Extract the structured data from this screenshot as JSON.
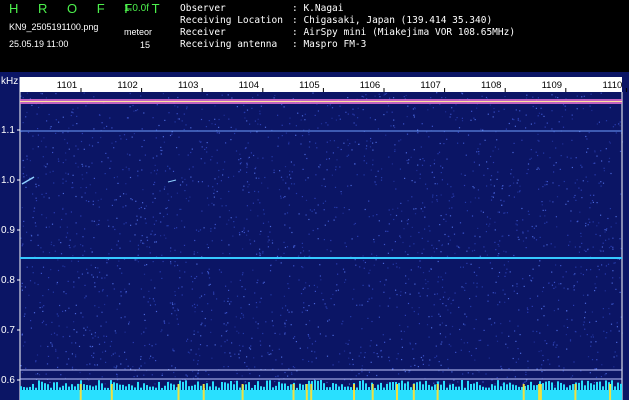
{
  "header": {
    "brand": "H R O F F T",
    "version": "1.0.0f",
    "filename": "KN9_2505191100.png",
    "meteor_label": "meteor",
    "date": "25.05.19 11:00",
    "meteor_count": "15"
  },
  "meta": [
    {
      "key": "Observer",
      "value": ": K.Nagai"
    },
    {
      "key": "Receiving Location",
      "value": ": Chigasaki, Japan (139.414 35.340)"
    },
    {
      "key": "Receiver",
      "value": ": AirSpy mini (Miakejima VOR 108.65MHz)"
    },
    {
      "key": "Receiving antenna",
      "value": ": Maspro FM-3"
    }
  ],
  "plot": {
    "y_unit": "kHz",
    "y_ticks": [
      "1.1",
      "1.0",
      "0.9",
      "0.8",
      "0.7",
      "0.6"
    ],
    "x_ticks": [
      "1101",
      "1102",
      "1103",
      "1104",
      "1105",
      "1106",
      "1107",
      "1108",
      "1109",
      "1110"
    ],
    "colors": {
      "background": "#0b1565",
      "noise": "#3a52c8",
      "carrier": "#e070d0",
      "line": "#35c8ff",
      "bottom_bar": "#29e0ff",
      "tick_bar": "#f0e040"
    }
  }
}
